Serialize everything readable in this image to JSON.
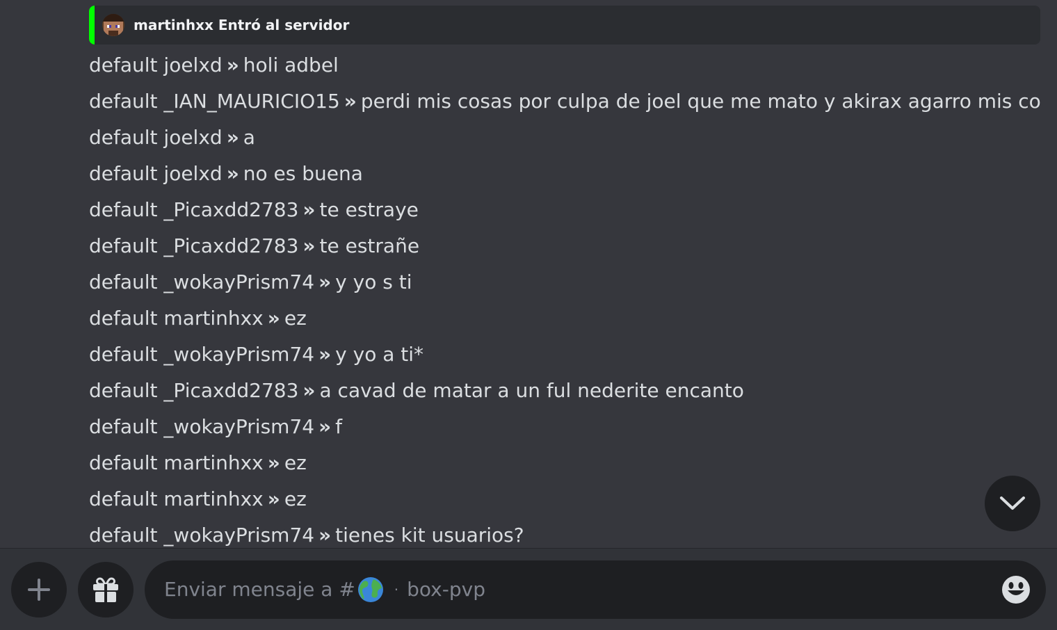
{
  "embed": {
    "text": "martinhxx Entró al servidor",
    "accent_color": "#00ff00"
  },
  "messages": [
    {
      "prefix": "default joelxd",
      "sep": "»",
      "text": "holi adbel"
    },
    {
      "prefix": "default _IAN_MAURICIO15",
      "sep": "»",
      "text": "perdi mis cosas por culpa de joel que me mato y akirax agarro mis cosas"
    },
    {
      "prefix": "default joelxd",
      "sep": "»",
      "text": "a"
    },
    {
      "prefix": "default joelxd",
      "sep": "»",
      "text": "no es buena"
    },
    {
      "prefix": "default _Picaxdd2783",
      "sep": "»",
      "text": "te estraye"
    },
    {
      "prefix": "default _Picaxdd2783",
      "sep": "»",
      "text": "te estrañe"
    },
    {
      "prefix": "default _wokayPrism74",
      "sep": "»",
      "text": "y yo s ti"
    },
    {
      "prefix": "default martinhxx",
      "sep": "»",
      "text": "ez"
    },
    {
      "prefix": "default _wokayPrism74",
      "sep": "»",
      "text": "y yo a ti*"
    },
    {
      "prefix": "default _Picaxdd2783",
      "sep": "»",
      "text": "a cavad de matar a un ful nederite encanto"
    },
    {
      "prefix": "default _wokayPrism74",
      "sep": "»",
      "text": "f"
    },
    {
      "prefix": "default martinhxx",
      "sep": "»",
      "text": "ez"
    },
    {
      "prefix": "default martinhxx",
      "sep": "»",
      "text": "ez"
    },
    {
      "prefix": "default _wokayPrism74",
      "sep": "»",
      "text": "tienes kit usuarios?"
    }
  ],
  "composer": {
    "placeholder_prefix": "Enviar mensaje a #",
    "channel_emoji_icon": "globe-icon",
    "separator": "·",
    "channel_name": "box-pvp"
  },
  "icons": {
    "add": "plus-icon",
    "gift": "gift-icon",
    "emoji": "smile-icon",
    "scroll": "chevron-down-icon"
  }
}
